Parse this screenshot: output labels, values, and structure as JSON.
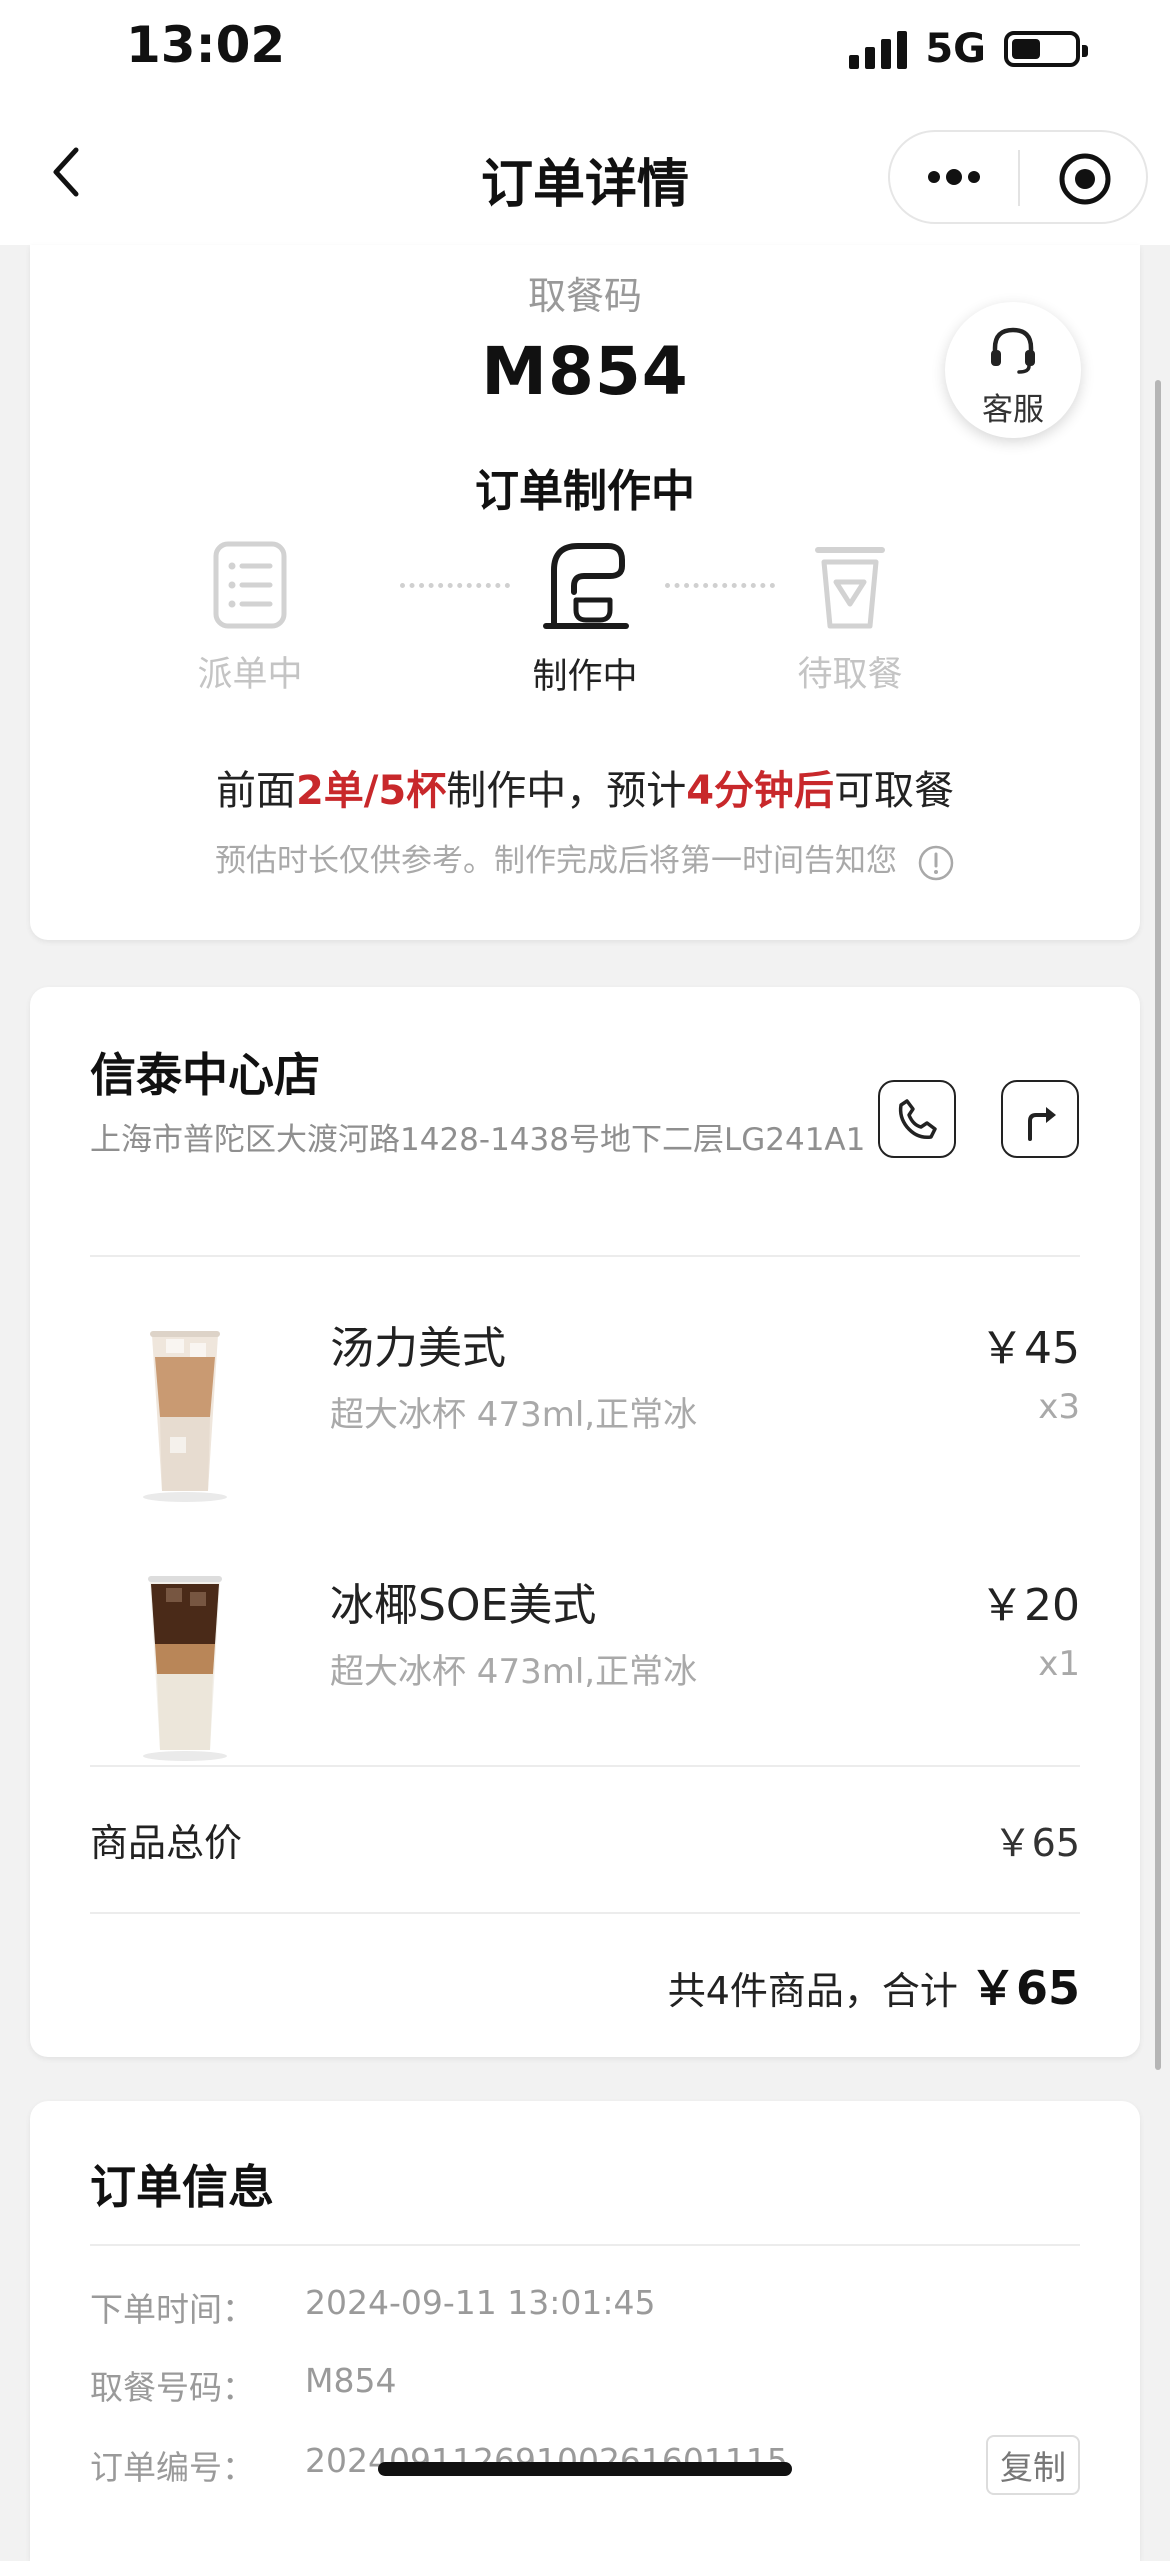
{
  "status_bar": {
    "time": "13:02",
    "network": "5G"
  },
  "nav": {
    "title": "订单详情"
  },
  "pickup": {
    "code_label": "取餐码",
    "code": "M854",
    "state": "订单制作中",
    "customer_service": "客服",
    "steps": [
      {
        "label": "派单中",
        "active": false
      },
      {
        "label": "制作中",
        "active": true
      },
      {
        "label": "待取餐",
        "active": false
      }
    ],
    "progress": {
      "p1": "前面",
      "count": "2单/5杯",
      "p2": "制作中，预计",
      "eta": "4分钟后",
      "p3": "可取餐"
    },
    "hint": "预估时长仅供参考。制作完成后将第一时间告知您"
  },
  "store": {
    "name": "信泰中心店",
    "address": "上海市普陀区大渡河路1428-1438号地下二层LG241A1"
  },
  "items": [
    {
      "name": "汤力美式",
      "spec": "超大冰杯 473ml,正常冰",
      "price": "￥45",
      "qty": "x3"
    },
    {
      "name": "冰椰SOE美式",
      "spec": "超大冰杯 473ml,正常冰",
      "price": "￥20",
      "qty": "x1"
    }
  ],
  "summary": {
    "subtotal_label": "商品总价",
    "subtotal_value": "￥65",
    "total_prefix": "共4件商品，合计",
    "total_amount": "￥65"
  },
  "order_info": {
    "title": "订单信息",
    "rows": [
      {
        "label": "下单时间：",
        "value": "2024-09-11 13:01:45"
      },
      {
        "label": "取餐号码：",
        "value": "M854"
      },
      {
        "label": "订单编号：",
        "value": "20240911269100261601115"
      }
    ],
    "copy_label": "复制"
  }
}
